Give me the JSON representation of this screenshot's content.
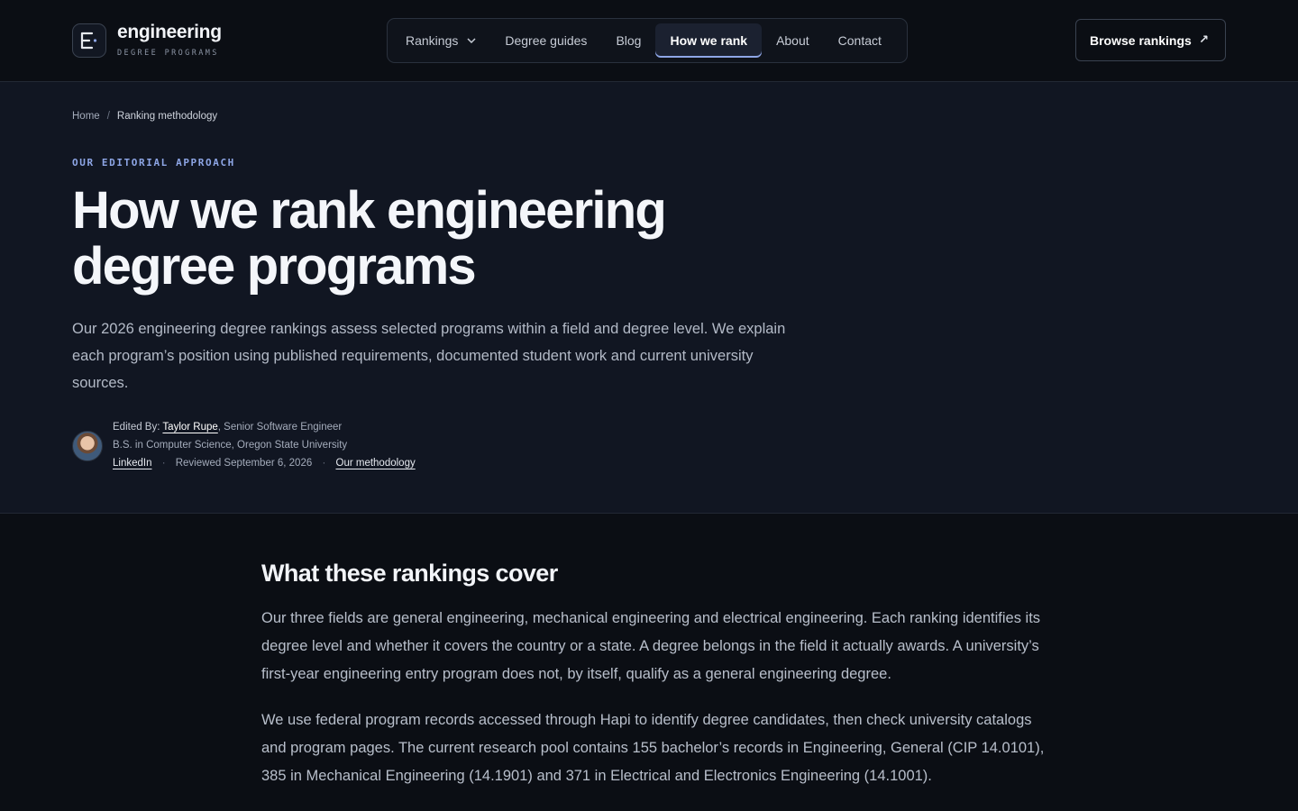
{
  "brand": {
    "name": "engineering",
    "subtitle": "DEGREE PROGRAMS",
    "accent": "#8ea6e6"
  },
  "nav": {
    "items": [
      {
        "label": "Rankings",
        "has_dropdown": true,
        "active": false
      },
      {
        "label": "Degree guides",
        "active": false
      },
      {
        "label": "Blog",
        "active": false
      },
      {
        "label": "How we rank",
        "active": true
      },
      {
        "label": "About",
        "active": false
      },
      {
        "label": "Contact",
        "active": false
      }
    ],
    "cta_label": "Browse rankings",
    "cta_icon": "arrow-up-right-icon"
  },
  "breadcrumb": {
    "home": "Home",
    "separator": "/",
    "current": "Ranking methodology"
  },
  "hero": {
    "eyebrow": "OUR EDITORIAL APPROACH",
    "title": "How we rank engineering degree programs",
    "lead": "Our 2026 engineering degree rankings assess selected programs within a field and degree level. We explain each program’s position using published requirements, documented student work and current university sources."
  },
  "author": {
    "edited_by_label": "Edited By:",
    "name": "Taylor Rupe",
    "role": ", Senior Software Engineer",
    "education": "B.S. in Computer Science, Oregon State University",
    "linkedin": "LinkedIn",
    "reviewed": "Reviewed September 6, 2026",
    "methodology_link": "Our methodology",
    "dot": "·"
  },
  "content": {
    "section_title": "What these rankings cover",
    "paragraphs": [
      "Our three fields are general engineering, mechanical engineering and electrical engineering. Each ranking identifies its degree level and whether it covers the country or a state. A degree belongs in the field it actually awards. A university’s first-year engineering entry program does not, by itself, qualify as a general engineering degree.",
      "We use federal program records accessed through Hapi to identify degree candidates, then check university catalogs and program pages. The current research pool contains 155 bachelor’s records in Engineering, General (CIP 14.0101), 385 in Mechanical Engineering (14.1901) and 371 in Electrical and Electronics Engineering (14.1001)."
    ]
  }
}
